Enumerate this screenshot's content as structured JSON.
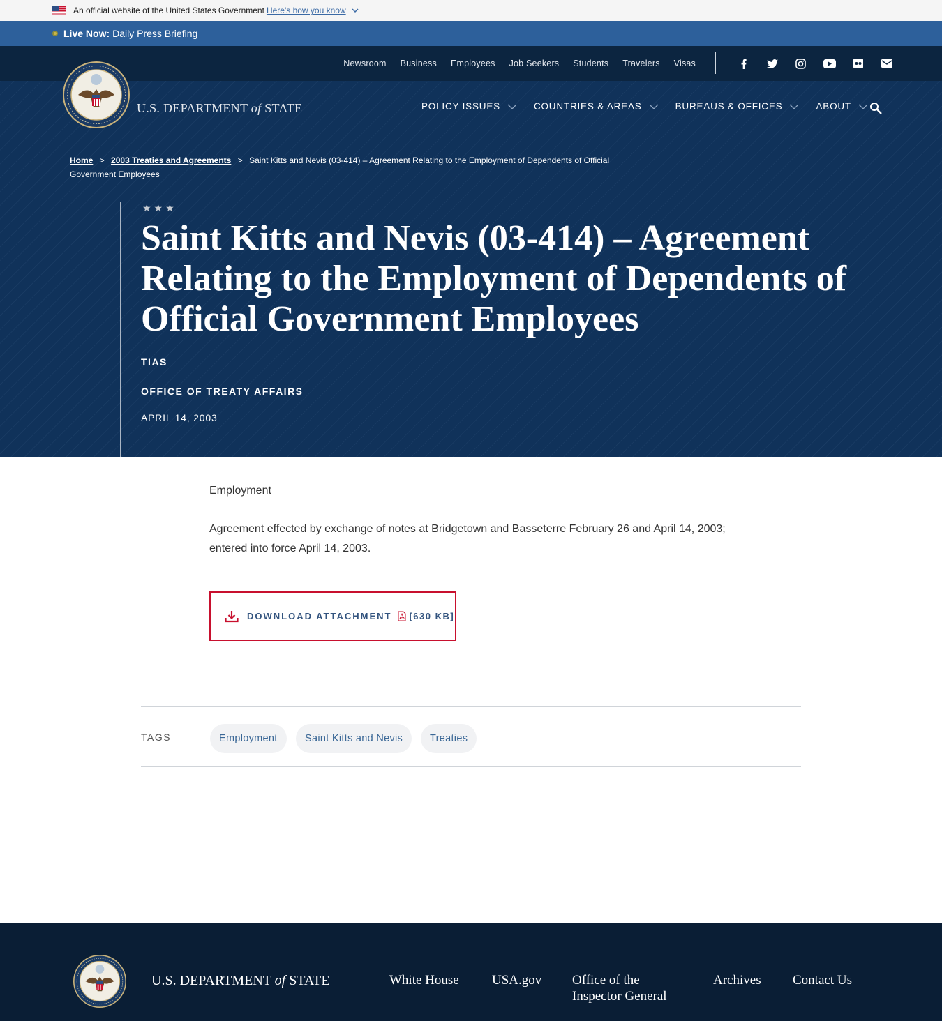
{
  "gov_banner": {
    "text": "An official website of the United States Government",
    "link": "Here's how you know"
  },
  "live": {
    "label": "Live Now:",
    "link": "Daily Press Briefing"
  },
  "utility_nav": [
    "Newsroom",
    "Business",
    "Employees",
    "Job Seekers",
    "Students",
    "Travelers",
    "Visas"
  ],
  "social_icons": [
    "facebook-icon",
    "twitter-icon",
    "instagram-icon",
    "youtube-icon",
    "flickr-icon",
    "email-icon"
  ],
  "header": {
    "dept_prefix": "U.S. DEPARTMENT",
    "dept_of": "of",
    "dept_suffix": "STATE",
    "nav": [
      "POLICY ISSUES",
      "COUNTRIES & AREAS",
      "BUREAUS & OFFICES",
      "ABOUT"
    ]
  },
  "breadcrumb": {
    "home": "Home",
    "sep": ">",
    "parent": "2003 Treaties and Agreements",
    "current": "Saint Kitts and Nevis (03-414) – Agreement Relating to the Employment of Dependents of Official Government Employees"
  },
  "hero": {
    "stars": "★★★",
    "title": "Saint Kitts and Nevis (03-414) – Agreement Relating to the Employment of Dependents of Official Government Employees",
    "tias": "TIAS",
    "office": "OFFICE OF TREATY AFFAIRS",
    "date": "APRIL 14, 2003"
  },
  "content": {
    "lead": "Employment",
    "paragraph": "Agreement effected by exchange of notes at Bridgetown and Basseterre February 26 and April 14, 2003; entered into force April 14, 2003."
  },
  "download": {
    "label": "DOWNLOAD ATTACHMENT",
    "size": "[630 KB]"
  },
  "tags": {
    "label": "TAGS",
    "items": [
      "Employment",
      "Saint Kitts and Nevis",
      "Treaties"
    ]
  },
  "footer": {
    "dept_prefix": "U.S. DEPARTMENT",
    "dept_of": "of",
    "dept_suffix": "STATE",
    "links": [
      "White House",
      "USA.gov",
      "Office of the Inspector General",
      "Archives",
      "Contact Us"
    ]
  },
  "colors": {
    "hero_bg": "#10325a",
    "utility_bg": "#0c2540",
    "live_bar": "#2d609b",
    "footer_bg": "#0a1e35",
    "accent_red": "#c8102e",
    "link_blue": "#33547f"
  }
}
